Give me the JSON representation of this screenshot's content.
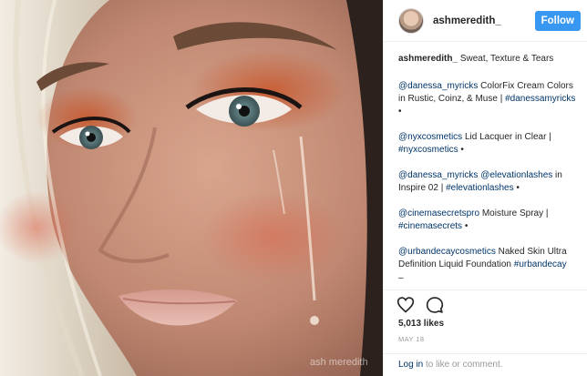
{
  "photo": {
    "alt": "Close-up portrait with copper glitter eyeshadow, long lashes and glossy tears",
    "watermark": "ash meredith"
  },
  "header": {
    "username": "ashmeredith_",
    "follow_label": "Follow"
  },
  "caption": {
    "username": "ashmeredith_",
    "text": "Sweat, Texture & Tears"
  },
  "comments": [
    {
      "handle": "@danessa_myricks",
      "text": " ColorFix Cream Colors in Rustic, Coinz, & Muse | ",
      "tag": "#danessamyricks"
    },
    {
      "handle": "@nyxcosmetics",
      "text": " Lid Lacquer in Clear | ",
      "tag": "#nyxcosmetics"
    },
    {
      "handle": "@danessa_myricks",
      "mid": "@elevationlashes",
      "text": " in Inspire 02 | ",
      "tag": "#elevationlashes"
    },
    {
      "handle": "@cinemasecretspro",
      "text": " Moisture Spray | ",
      "tag": "#cinemasecrets"
    },
    {
      "handle": "@urbandecaycosmetics",
      "text": " Naked Skin Ultra Definition Liquid Foundation ",
      "tag": "#urbandecay"
    }
  ],
  "bullet": "•",
  "dash": "–",
  "actions": {
    "like_icon": "heart-icon",
    "comment_icon": "comment-icon",
    "likes": "5,013 likes",
    "date": "MAY 18"
  },
  "login": {
    "link": "Log in",
    "text": " to like or comment."
  },
  "colors": {
    "follow": "#3897f0",
    "link": "#003569",
    "muted": "#999999",
    "border": "#efefef"
  }
}
